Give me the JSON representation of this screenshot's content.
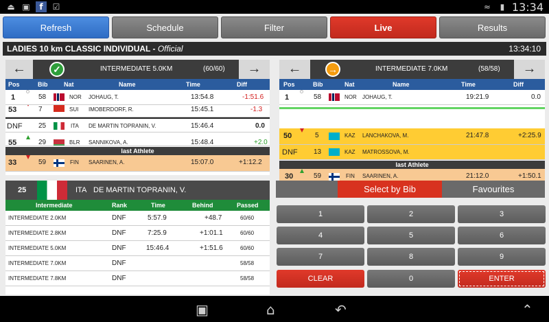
{
  "status_bar": {
    "time": "13:34",
    "icons": [
      "usb-icon",
      "image-icon",
      "facebook-icon",
      "clipboard-icon"
    ]
  },
  "nav": {
    "refresh": "Refresh",
    "schedule": "Schedule",
    "filter": "Filter",
    "live": "Live",
    "results": "Results"
  },
  "race": {
    "title": "LADIES 10 km CLASSIC INDIVIDUAL",
    "status": "Official",
    "clock": "13:34:10"
  },
  "columns": {
    "pos": "Pos",
    "bib": "Bib",
    "nat": "Nat",
    "name": "Name",
    "time": "Time",
    "diff": "Diff"
  },
  "left_panel": {
    "intermediate": "INTERMEDIATE 5.0KM",
    "count": "(60/60)",
    "rows": [
      {
        "pos": "1",
        "bib": "58",
        "nat": "NOR",
        "name": "JOHAUG, T.",
        "time": "13:54.8",
        "diff": "-1:51.6"
      },
      {
        "pos": "53",
        "bib": "7",
        "nat": "SUI",
        "name": "IMOBERDORF, R.",
        "time": "15:45.1",
        "diff": "-1.3"
      },
      {
        "pos": "DNF",
        "bib": "25",
        "nat": "ITA",
        "name": "DE MARTIN TOPRANIN, V.",
        "time": "15:46.4",
        "diff": "0.0"
      },
      {
        "pos": "55",
        "bib": "29",
        "nat": "BLR",
        "name": "SANNIKOVA, A.",
        "time": "15:48.4",
        "diff": "+2.0"
      }
    ],
    "last_label": "last Athlete",
    "last": {
      "pos": "33",
      "bib": "59",
      "nat": "FIN",
      "name": "SAARINEN, A.",
      "time": "15:07.0",
      "diff": "+1:12.2"
    }
  },
  "right_panel": {
    "intermediate": "INTERMEDIATE 7.0KM",
    "count": "(58/58)",
    "rows": [
      {
        "pos": "1",
        "bib": "58",
        "nat": "NOR",
        "name": "JOHAUG, T.",
        "time": "19:21.9",
        "diff": "0.0"
      },
      {
        "pos": "50",
        "bib": "5",
        "nat": "KAZ",
        "name": "LANCHAKOVA, M.",
        "time": "21:47.8",
        "diff": "+2:25.9"
      },
      {
        "pos": "DNF",
        "bib": "13",
        "nat": "KAZ",
        "name": "MATROSSOVA, M.",
        "time": "",
        "diff": ""
      }
    ],
    "last_label": "last Athlete",
    "last": {
      "pos": "30",
      "bib": "59",
      "nat": "FIN",
      "name": "SAARINEN, A.",
      "time": "21:12.0",
      "diff": "+1:50.1"
    }
  },
  "athlete": {
    "bib": "25",
    "nat": "ITA",
    "name": "DE MARTIN TOPRANIN, V.",
    "headers": {
      "intermediate": "Intermediate",
      "rank": "Rank",
      "time": "Time",
      "behind": "Behind",
      "passed": "Passed"
    },
    "rows": [
      {
        "intermediate": "INTERMEDIATE 2.0KM",
        "rank": "DNF",
        "time": "5:57.9",
        "behind": "+48.7",
        "passed": "60/60"
      },
      {
        "intermediate": "INTERMEDIATE 2.8KM",
        "rank": "DNF",
        "time": "7:25.9",
        "behind": "+1:01.1",
        "passed": "60/60"
      },
      {
        "intermediate": "INTERMEDIATE 5.0KM",
        "rank": "DNF",
        "time": "15:46.4",
        "behind": "+1:51.6",
        "passed": "60/60"
      },
      {
        "intermediate": "INTERMEDIATE 7.0KM",
        "rank": "DNF",
        "time": "",
        "behind": "",
        "passed": "58/58"
      },
      {
        "intermediate": "INTERMEDIATE 7.8KM",
        "rank": "DNF",
        "time": "",
        "behind": "",
        "passed": "58/58"
      }
    ]
  },
  "tabs": {
    "select_by_bib": "Select by Bib",
    "favourites": "Favourites"
  },
  "keypad": {
    "k1": "1",
    "k2": "2",
    "k3": "3",
    "k4": "4",
    "k5": "5",
    "k6": "6",
    "k7": "7",
    "k8": "8",
    "k9": "9",
    "clear": "CLEAR",
    "k0": "0",
    "enter": "ENTER"
  },
  "colors": {
    "accent_blue": "#2f6cc4",
    "live_red": "#d8321f",
    "highlight_orange": "#f8c993",
    "highlight_yellow": "#ffcc33",
    "header_green": "#1f8c3a"
  }
}
